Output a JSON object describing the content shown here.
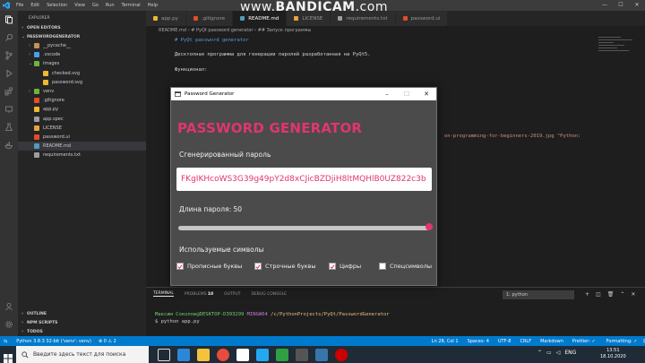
{
  "watermark": {
    "prefix": "www.",
    "brand": "BANDICAM",
    "suffix": ".com"
  },
  "menu": [
    "File",
    "Edit",
    "Selection",
    "View",
    "Go",
    "Run",
    "Terminal",
    "Help"
  ],
  "explorer": {
    "title": "EXPLORER",
    "open_editors": "OPEN EDITORS",
    "project": "PASSWORDGENERATOR",
    "items": [
      {
        "label": "__pycache__",
        "icon_color": "#c09553",
        "chev": "›"
      },
      {
        "label": ".vscode",
        "icon_color": "#4a9ff0",
        "chev": "›"
      },
      {
        "label": "images",
        "icon_color": "#6db33f",
        "chev": "⌄"
      },
      {
        "label": "checked.svg",
        "icon_color": "#f0b72f",
        "chev": ""
      },
      {
        "label": "password.svg",
        "icon_color": "#f0b72f",
        "chev": ""
      },
      {
        "label": "venv",
        "icon_color": "#6db33f",
        "chev": "›"
      },
      {
        "label": ".gitignore",
        "icon_color": "#e44d26",
        "chev": ""
      },
      {
        "label": "app.py",
        "icon_color": "#f0b72f",
        "chev": ""
      },
      {
        "label": "app.spec",
        "icon_color": "#9e9e9e",
        "chev": ""
      },
      {
        "label": "LICENSE",
        "icon_color": "#e8a33d",
        "chev": ""
      },
      {
        "label": "password.ui",
        "icon_color": "#e44d26",
        "chev": ""
      },
      {
        "label": "README.md",
        "icon_color": "#519aba",
        "chev": ""
      },
      {
        "label": "requirements.txt",
        "icon_color": "#9e9e9e",
        "chev": ""
      }
    ],
    "bottom": [
      "OUTLINE",
      "NPM SCRIPTS",
      "TODOS"
    ]
  },
  "tabs": [
    {
      "label": "app.py",
      "icon_color": "#f0b72f"
    },
    {
      "label": ".gitignore",
      "icon_color": "#e44d26"
    },
    {
      "label": "README.md",
      "icon_color": "#519aba"
    },
    {
      "label": "LICENSE",
      "icon_color": "#e8a33d"
    },
    {
      "label": "requirements.txt",
      "icon_color": "#9e9e9e"
    },
    {
      "label": "password.ui",
      "icon_color": "#e44d26"
    }
  ],
  "breadcrumb": "README.md › # PyQt password generator › ## Запуск программы",
  "editor": {
    "lines": [
      {
        "text": "# PyQt password generator",
        "color": "#569cd6"
      },
      {
        "text": "Десктопная программа для генерации паролей разработанная на PyQt5.",
        "color": "#d4d4d4"
      },
      {
        "text": "Функционал:",
        "color": "#d4d4d4"
      },
      {
        "text": "on-programming-for-beginners-2019.jpg \"Python:",
        "color": "#ce9178"
      }
    ]
  },
  "panel": {
    "tabs": [
      "TERMINAL",
      "PROBLEMS",
      "10",
      "OUTPUT",
      "DEBUG CONSOLE"
    ],
    "terminal_select": "1: python",
    "prompt_user": "Максим Соколов@DESKTOP-D393299",
    "prompt_env": "MINGW64",
    "prompt_path": "/c/PythonProjects/PyQt/PasswordGenerator",
    "command": "$ python app.py"
  },
  "statusbar": {
    "python": "Python 3.8.3 32-bit ('venv': venv)",
    "errors": "⊗ 0  ⚠ 2",
    "position": "Ln 28, Col 1",
    "spaces": "Spaces: 4",
    "encoding": "UTF-8",
    "eol": "CRLF",
    "language": "Markdown",
    "prettier": "Prettier: ✓",
    "formatting": "Formatting: ✓"
  },
  "taskbar": {
    "search_placeholder": "Введите здесь текст для поиска",
    "lang": "ENG",
    "time": "13:51",
    "date": "18.10.2020"
  },
  "dialog": {
    "window_title": "Password Generator",
    "heading": "PASSWORD GENERATOR",
    "generated_label": "Сгенерированный пароль",
    "password": "FKgIKHcoWS3G39g49pY2d8xCJicBZDjiH8ltMQHlB0UZ822c3b",
    "length_label": "Длина пароля: 50",
    "length_fraction": 1.0,
    "symbols_label": "Используемые символы",
    "checkboxes": [
      {
        "label": "Прописные буквы",
        "checked": true
      },
      {
        "label": "Строчные буквы",
        "checked": true
      },
      {
        "label": "Цифры",
        "checked": true
      },
      {
        "label": "Спецсимволы",
        "checked": false
      }
    ],
    "accent": "#e1356e"
  },
  "colors": {
    "statusbar": "#007acc",
    "activity": "#333333",
    "sidebar": "#252526",
    "editor": "#1e1e1e"
  }
}
